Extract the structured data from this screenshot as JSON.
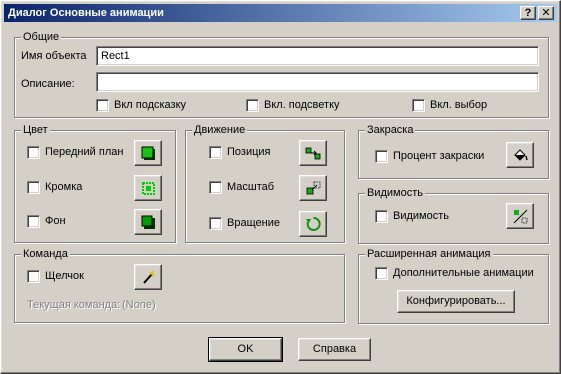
{
  "window": {
    "title": "Диалог Основные анимации",
    "help_btn": "?",
    "close_btn": "✕"
  },
  "general": {
    "label": "Общие",
    "object_name_label": "Имя объекта",
    "object_name_value": "Rect1",
    "description_label": "Описание:",
    "description_value": "",
    "tooltip_label": "Вкл подсказку",
    "highlight_label": "Вкл. подсветку",
    "selection_label": "Вкл. выбор"
  },
  "color": {
    "label": "Цвет",
    "foreground_label": "Передний план",
    "border_label": "Кромка",
    "background_label": "Фон"
  },
  "motion": {
    "label": "Движение",
    "position_label": "Позиция",
    "scale_label": "Масштаб",
    "rotation_label": "Вращение"
  },
  "fill": {
    "label": "Закраска",
    "percent_label": "Процент закраски"
  },
  "visibility": {
    "label": "Видимость",
    "visible_label": "Видимость"
  },
  "command": {
    "label": "Команда",
    "click_label": "Щелчок",
    "current_label": "Текущая команда:",
    "current_value": "(None)"
  },
  "advanced": {
    "label": "Расширенная анимация",
    "extra_label": "Дополнительные анимации",
    "configure_button": "Конфигурировать..."
  },
  "footer": {
    "ok_button": "OK",
    "help_button": "Справка"
  },
  "colors": {
    "title_start": "#0a246a",
    "title_end": "#a6caf0",
    "face": "#d4d0c8"
  }
}
